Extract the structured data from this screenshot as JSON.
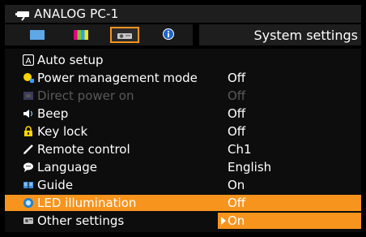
{
  "header": {
    "source_name": "ANALOG PC-1",
    "input_icon": "projector-input-icon"
  },
  "tabs": [
    {
      "name": "tab-input-settings",
      "icon": "screen-icon",
      "active": false
    },
    {
      "name": "tab-image-adjustment",
      "icon": "color-bars-icon",
      "active": false
    },
    {
      "name": "tab-system-settings",
      "icon": "projector-icon",
      "active": true
    },
    {
      "name": "tab-information",
      "icon": "info-icon",
      "active": false
    }
  ],
  "section_title": "System settings",
  "menu": {
    "items": [
      {
        "label": "Auto setup",
        "value": "",
        "icon": "auto-setup-icon",
        "state": "normal"
      },
      {
        "label": "Power management mode",
        "value": "Off",
        "icon": "power-bulb-icon",
        "state": "normal"
      },
      {
        "label": "Direct power on",
        "value": "Off",
        "icon": "power-socket-icon",
        "state": "disabled"
      },
      {
        "label": "Beep",
        "value": "Off",
        "icon": "speaker-icon",
        "state": "normal"
      },
      {
        "label": "Key lock",
        "value": "Off",
        "icon": "lock-icon",
        "state": "normal"
      },
      {
        "label": "Remote control",
        "value": "Ch1",
        "icon": "remote-pen-icon",
        "state": "normal"
      },
      {
        "label": "Language",
        "value": "English",
        "icon": "speech-bubble-icon",
        "state": "normal"
      },
      {
        "label": "Guide",
        "value": "On",
        "icon": "book-icon",
        "state": "normal"
      },
      {
        "label": "LED illumination",
        "value": "Off",
        "icon": "led-icon",
        "state": "highlight"
      },
      {
        "label": "Other settings",
        "value": "On",
        "icon": "other-settings-icon",
        "state": "selected-value"
      }
    ]
  },
  "colors": {
    "accent": "#f7941d",
    "disabled_text": "#5a5a5a",
    "background": "#000000"
  }
}
